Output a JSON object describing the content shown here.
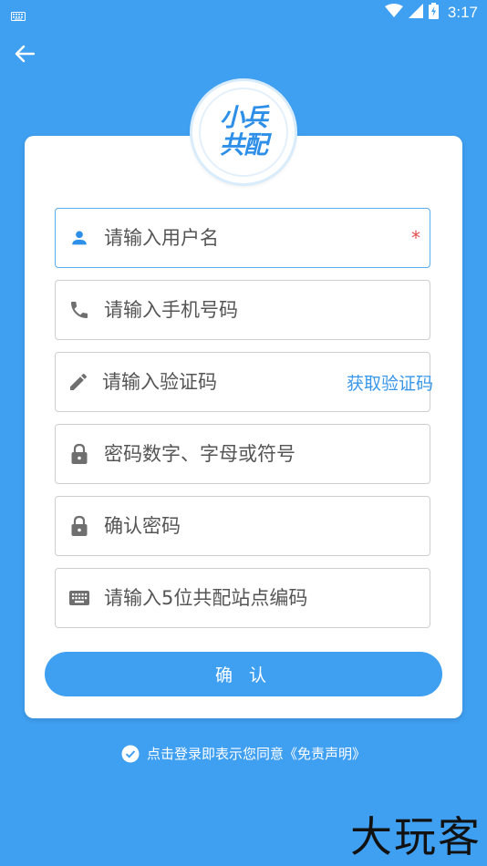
{
  "status_bar": {
    "time": "3:17"
  },
  "logo": {
    "line1": "小兵",
    "line2": "共配"
  },
  "form": {
    "username": {
      "placeholder": "请输入用户名",
      "required_mark": "*"
    },
    "phone": {
      "placeholder": "请输入手机号码"
    },
    "code": {
      "placeholder": "请输入验证码",
      "get_code_label": "获取验证码"
    },
    "password": {
      "placeholder": "密码数字、字母或符号"
    },
    "confirm_password": {
      "placeholder": "确认密码"
    },
    "station_code": {
      "placeholder": "请输入5位共配站点编码"
    },
    "confirm_label": "确 认"
  },
  "agreement": {
    "text": "点击登录即表示您同意《免责声明》"
  },
  "watermark": {
    "text": "大玩客"
  },
  "colors": {
    "primary": "#3f9ff0",
    "accent_text": "#3a97e8",
    "required": "#e34d4d",
    "icon_grey": "#6f6f6f",
    "icon_blue": "#2e8fe8"
  }
}
